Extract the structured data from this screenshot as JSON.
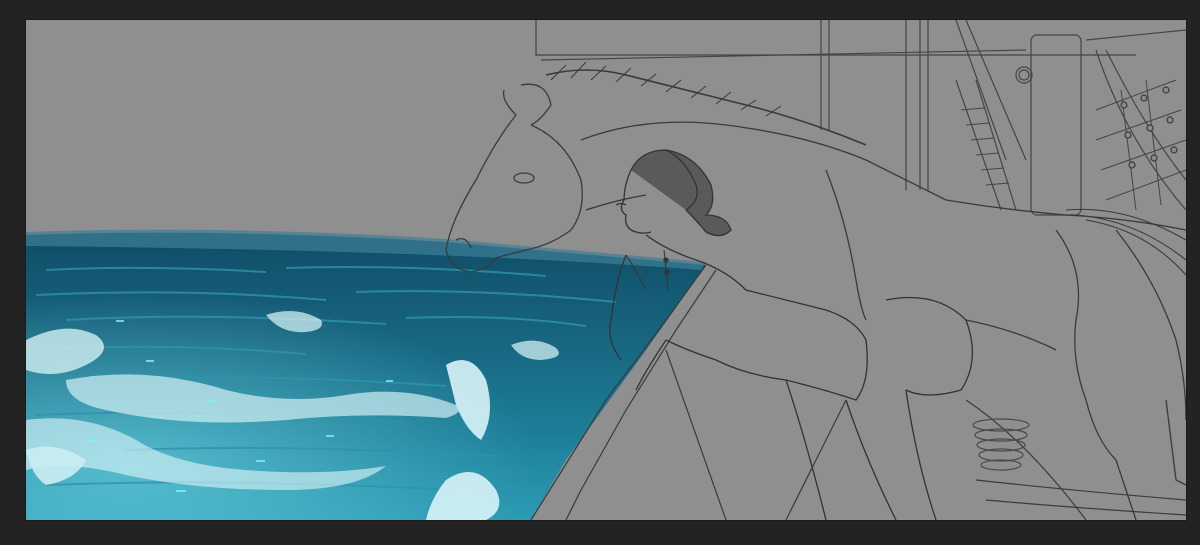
{
  "app": {
    "workspace_background": "#232323",
    "canvas_background": "#8f8f8f"
  },
  "artwork": {
    "palette": {
      "sea_deep": "#0c4a63",
      "sea_mid": "#1f7f9a",
      "sea_light": "#5fc8d8",
      "foam": "#d8f4f8",
      "sketch_line": "#3a3a3a",
      "sketch_fill": "#959595"
    },
    "layers": [
      "sky",
      "sea",
      "waves",
      "ship-rigging",
      "horse-sketch",
      "woman-sketch",
      "hull-sketch"
    ]
  }
}
